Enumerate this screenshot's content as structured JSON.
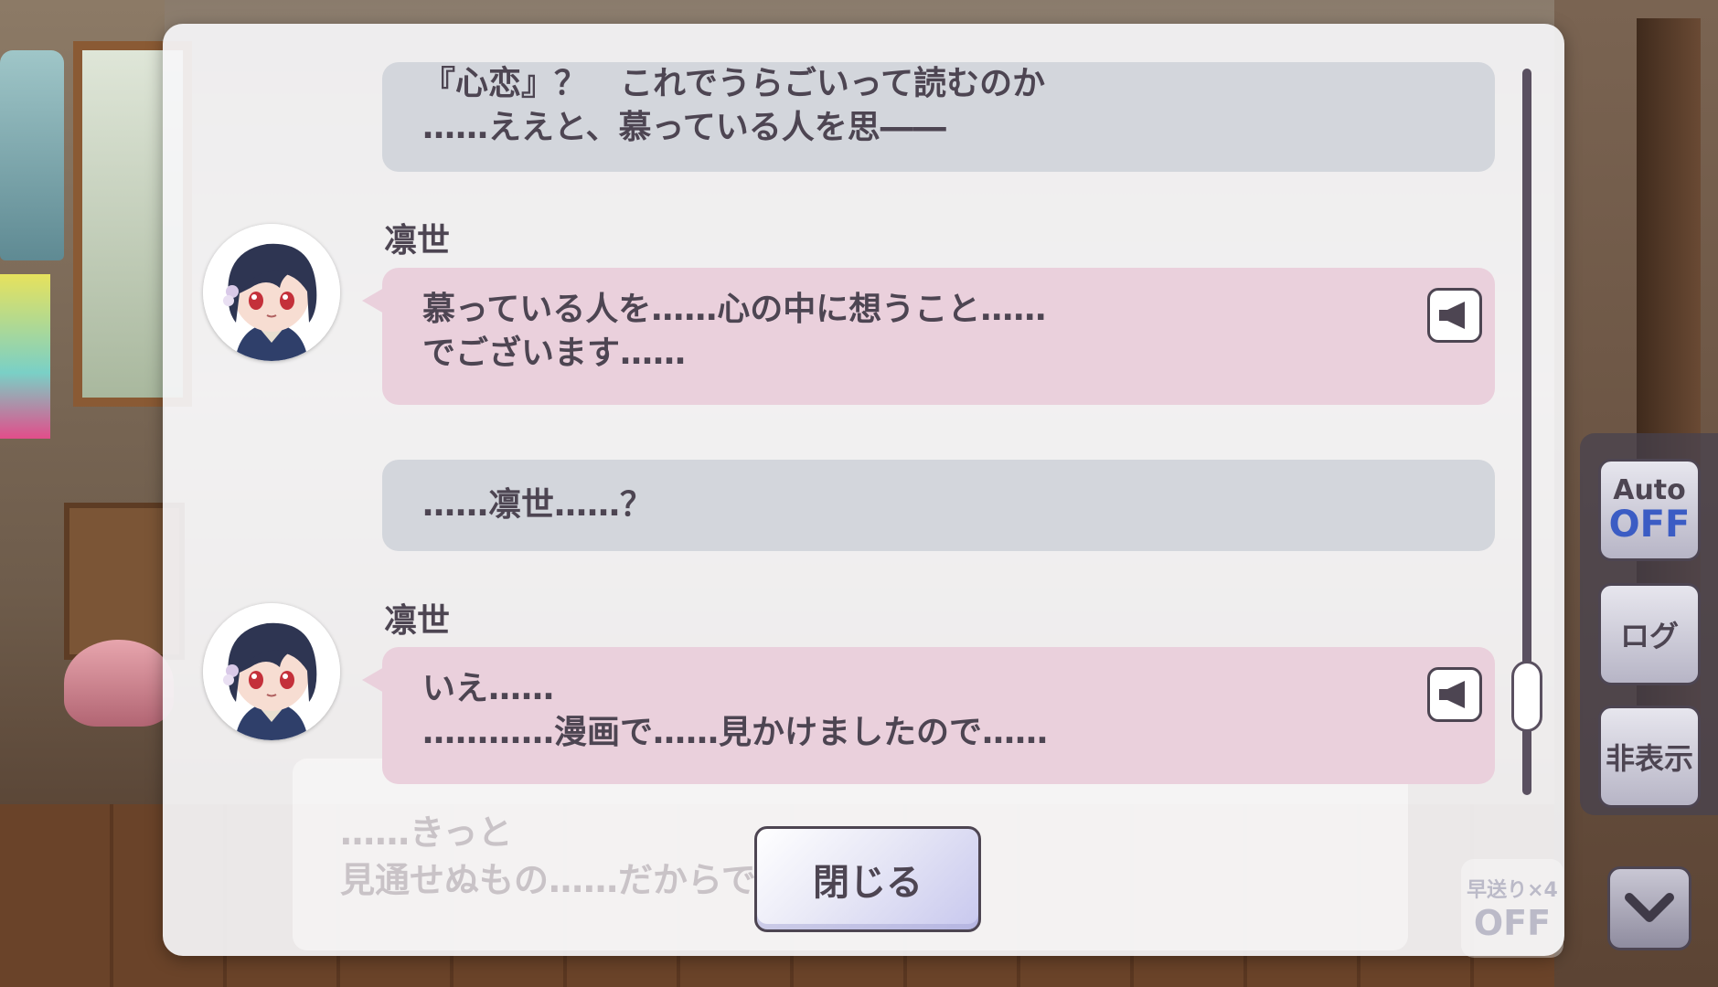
{
  "log": [
    {
      "type": "narration",
      "lines": [
        "『心恋』？　これでうらごいって読むのか",
        "……ええと、慕っている人を思――"
      ]
    },
    {
      "type": "dialogue",
      "speaker": "凛世",
      "avatar": "rinze-portrait-icon",
      "lines": [
        "慕っている人を……心の中に想うこと……",
        "でございます……"
      ],
      "voice_icon": "speaker-icon"
    },
    {
      "type": "narration",
      "lines": [
        "……凛世……？"
      ]
    },
    {
      "type": "dialogue",
      "speaker": "凛世",
      "avatar": "rinze-portrait-icon",
      "lines": [
        "いえ……",
        "…………漫画で……見かけましたので……"
      ],
      "voice_icon": "speaker-icon"
    }
  ],
  "underlying_text": [
    "……きっと",
    "見通せぬもの……だからで"
  ],
  "buttons": {
    "close": "閉じる"
  },
  "side_controls": {
    "auto_label": "Auto",
    "auto_state": "OFF",
    "log_label": "ログ",
    "hide_label": "非表示",
    "skip_label": "早送り×4",
    "skip_state": "OFF",
    "collapse_icon": "chevron-down-icon"
  },
  "colors": {
    "narration_bubble": "#d3d6dc",
    "dialogue_bubble": "#ead0dc",
    "text": "#4d4552",
    "auto_state": "#3b5cc4"
  }
}
